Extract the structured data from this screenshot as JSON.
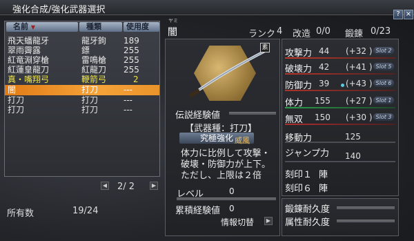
{
  "window": {
    "title": "強化合成/強化武器選択",
    "help_label": "?",
    "close_label": "×"
  },
  "list": {
    "headers": {
      "name": "名前",
      "type": "種類",
      "uses": "使用度"
    },
    "rows": [
      {
        "name": "飛天蟠龍牙",
        "type": "龍牙鉤",
        "uses": "189"
      },
      {
        "name": "翠雨霽露",
        "type": "鏢",
        "uses": "255"
      },
      {
        "name": "紅竜淵穿槍",
        "type": "雷鳴槍",
        "uses": "255"
      },
      {
        "name": "紅蓮皇龍刀",
        "type": "紅龍刀",
        "uses": "255"
      },
      {
        "name": "真・嘴翔弓",
        "type": "鞭箭弓",
        "uses": "2"
      },
      {
        "name": "闇",
        "type": "打刀",
        "uses": "---"
      },
      {
        "name": "打刀",
        "type": "打刀",
        "uses": "---"
      },
      {
        "name": "打刀",
        "type": "打刀",
        "uses": "---"
      }
    ],
    "page": "2/ 2",
    "owned_label": "所有数",
    "owned_value": "19/24"
  },
  "weapon": {
    "furigana": "ヤミ",
    "name": "闇",
    "rank_label": "ランク",
    "rank_value": "4",
    "kaizo_label": "改造",
    "kaizo_value": "0/0",
    "tanren_label": "鍛錬",
    "tanren_value": "0/23",
    "tag": "素",
    "legend_exp_label": "伝説経験値",
    "type_label": "【武器種：打刀】",
    "skill_name": "究極強化",
    "skill_kind": "威風",
    "skill_desc_1": "体力に比例して攻撃・",
    "skill_desc_2": "破壊・防御力が上下。",
    "skill_desc_3": "ただし、上限は２倍",
    "level_label": "レベル",
    "level_value": "0",
    "cum_exp_label": "累積経験値",
    "cum_exp_value": "0",
    "info_switch_label": "情報切替"
  },
  "stats": [
    {
      "label": "攻撃力",
      "value": "44",
      "bonus": "(+32 )",
      "slot": "Slot 2"
    },
    {
      "label": "破壊力",
      "value": "42",
      "bonus": "(+41 )",
      "slot": "Slot 5"
    },
    {
      "label": "防御力",
      "value": "39",
      "bonus": "(+43 )",
      "slot": "Slot 6"
    },
    {
      "label": "体力",
      "value": "155",
      "bonus": "(+27 )",
      "slot": "Slot 1"
    },
    {
      "label": "無双",
      "value": "150",
      "bonus": "(+30 )",
      "slot": "Slot 3"
    }
  ],
  "extra_stats": [
    {
      "label": "移動力",
      "value": "125"
    },
    {
      "label": "ジャンプ力",
      "value": "140"
    }
  ],
  "marks": [
    {
      "label": "刻印１",
      "value": "陣"
    },
    {
      "label": "刻印６",
      "value": "陣"
    }
  ],
  "durability": {
    "tanren_label": "鍛錬耐久度",
    "zokusei_label": "属性耐久度"
  },
  "colors": {
    "selected_row": "#f29a35",
    "gold_row": "#f0e64a",
    "hex_badge": "#c9a45c",
    "attack_bar": "#c23a2a",
    "life_bar": "#2a9f4a",
    "musou_bar": "#b02d2d"
  },
  "icons": {
    "sort": "sort-down-icon",
    "left": "arrow-left-icon",
    "right": "arrow-right-icon"
  }
}
